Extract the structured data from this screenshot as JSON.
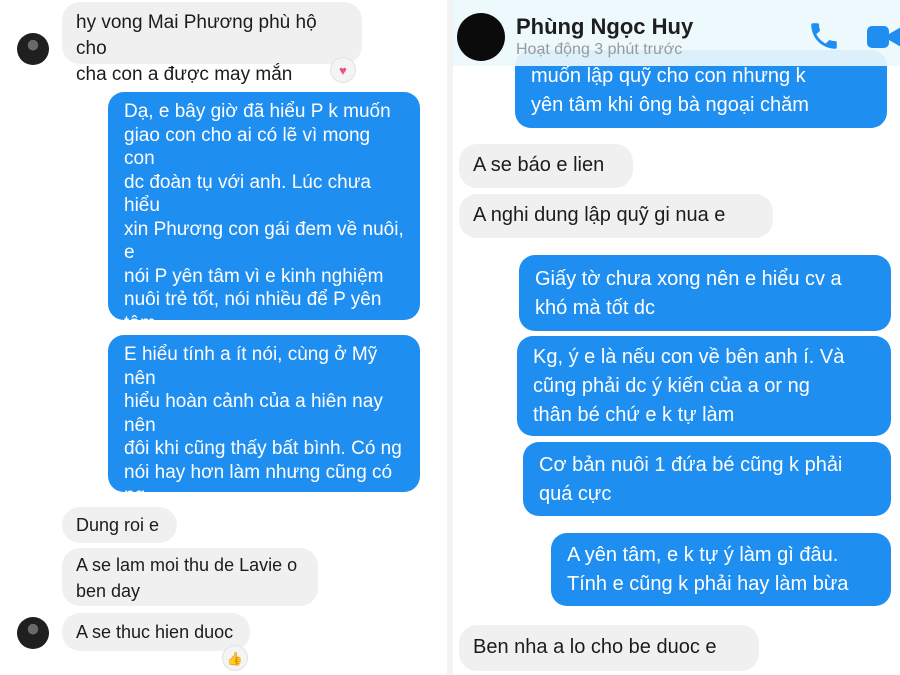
{
  "left": {
    "messages": [
      {
        "text": "hy vong Mai Phương phù hộ cho\ncha con a được may mắn"
      },
      {
        "text": "Dạ, e bây giờ đã hiểu P k muốn\ngiao con cho ai có lẽ vì mong con\ndc đoàn tụ với anh. Lúc chưa hiểu\nxin Phương con gái đem về nuôi, e\nnói P yên tâm vì e kinh nghiệm\nnuôi trẻ tốt, nói nhiều để P yên tâm\nnhưng trong mắt P hình như cũng\ncó điều gì đó, chắc là mong con về\nvới a"
      },
      {
        "text": "E hiểu tính a ít nói, cùng ở Mỹ nên\nhiểu hoàn cảnh của a hiên nay nên\nđôi khi cũng thấy bất bình. Có ng\nnói hay hơn làm nhưng cũng có ng\nk nói mà làm. Mình sống tốt sẽ dc\ntốt anh ạ"
      },
      {
        "text": "Dung roi e"
      },
      {
        "text": "A se lam moi thu de Lavie o\nben day"
      },
      {
        "text": "A se thuc hien duoc"
      }
    ],
    "reactions": {
      "heart": "♥",
      "like": "👍"
    }
  },
  "right": {
    "header": {
      "name": "Phùng Ngọc Huy",
      "status": "Hoạt động 3 phút trước"
    },
    "messages": [
      {
        "text": "muốn lập quỹ cho con nhưng k\nyên tâm khi ông bà ngoại chăm"
      },
      {
        "text": "A se báo e lien"
      },
      {
        "text": "A nghi dung lập quỹ gi nua e"
      },
      {
        "text": "Giấy tờ chưa xong nên e hiểu cv a\nkhó mà tốt dc"
      },
      {
        "text": "Kg, ý e là nếu con về bên anh í. Và\ncũng phải dc ý kiến của a or ng\nthân bé chứ e k tự làm"
      },
      {
        "text": "Cơ bản nuôi 1 đứa bé cũng k phải\nquá cực"
      },
      {
        "text": "A yên tâm, e k tự ý làm gì đâu.\nTính e cũng k phải hay làm bừa"
      },
      {
        "text": "Ben nha a lo cho be duoc e"
      }
    ]
  },
  "colors": {
    "outgoing_bubble": "#1f8ef1",
    "incoming_bubble": "#f1f0f0",
    "header_icons": "#1f8ef1"
  }
}
